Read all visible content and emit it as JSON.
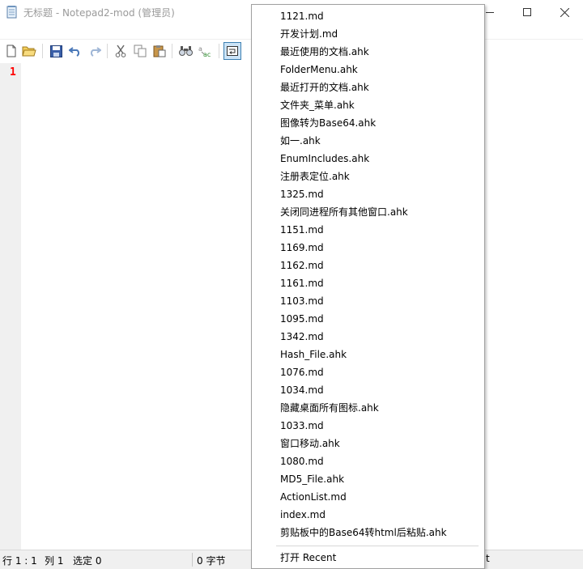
{
  "window": {
    "title": "无标题 - Notepad2-mod (管理员)"
  },
  "toolbar": {
    "buttons": [
      "new-file-icon",
      "open-folder-icon",
      "save-icon",
      "undo-icon",
      "redo-icon",
      "cut-icon",
      "copy-icon",
      "paste-icon",
      "find-icon",
      "replace-icon",
      "word-wrap-icon"
    ],
    "active_button": "word-wrap-icon"
  },
  "editor": {
    "line_numbers": [
      "1"
    ],
    "line_number_color": "#ff0000"
  },
  "statusbar": {
    "position": "行 1 : 1",
    "column": "列 1",
    "selection": "选定 0",
    "bytes": "0 字节",
    "tail": "t"
  },
  "menu": {
    "items": [
      "1121.md",
      "开发计划.md",
      "最近使用的文档.ahk",
      "FolderMenu.ahk",
      "最近打开的文档.ahk",
      "文件夹_菜单.ahk",
      "图像转为Base64.ahk",
      "如一.ahk",
      "EnumIncludes.ahk",
      "注册表定位.ahk",
      "1325.md",
      "关闭同进程所有其他窗口.ahk",
      "1151.md",
      "1169.md",
      "1162.md",
      "1161.md",
      "1103.md",
      "1095.md",
      "1342.md",
      "Hash_File.ahk",
      "1076.md",
      "1034.md",
      "隐藏桌面所有图标.ahk",
      "1033.md",
      "窗口移动.ahk",
      "1080.md",
      "MD5_File.ahk",
      "ActionList.md",
      "index.md",
      "剪贴板中的Base64转html后粘贴.ahk"
    ],
    "footer_item": "打开 Recent"
  }
}
